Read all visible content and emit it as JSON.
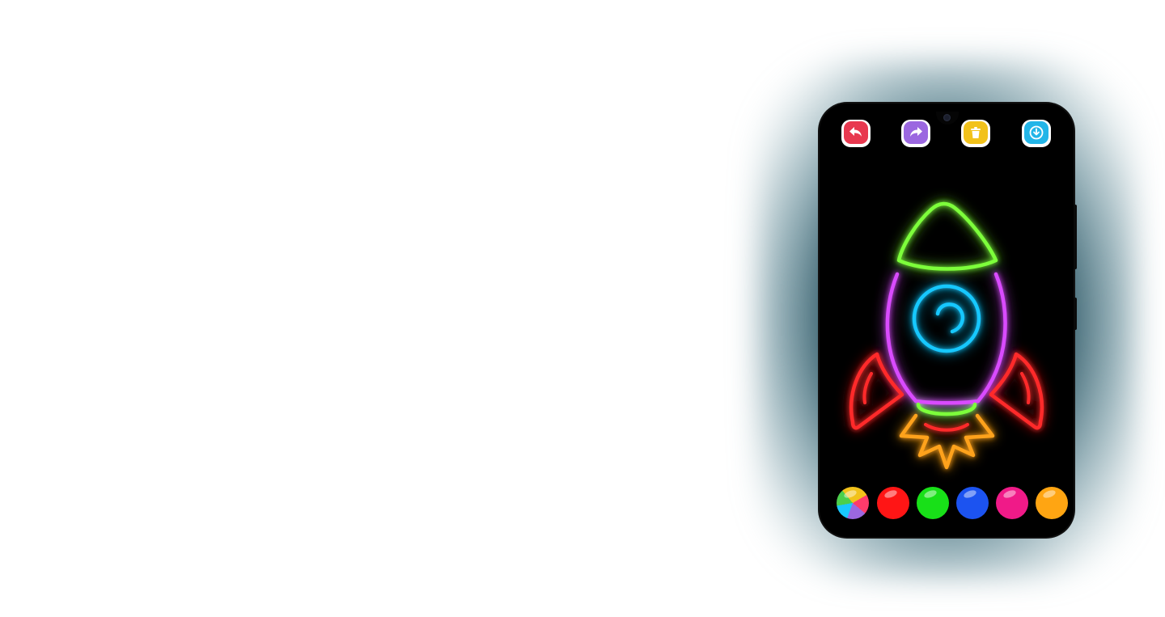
{
  "toolbar": {
    "buttons": [
      {
        "name": "undo",
        "icon": "undo-arrow-icon",
        "color": "#e8384f"
      },
      {
        "name": "redo",
        "icon": "redo-arrow-icon",
        "color": "#9b67e0"
      },
      {
        "name": "clear",
        "icon": "trash-icon",
        "color": "#f2c21b"
      },
      {
        "name": "save",
        "icon": "download-icon",
        "color": "#22b5e8"
      }
    ]
  },
  "artwork": {
    "subject": "rocket",
    "stroke_colors": {
      "nose_cone": "#7dff3a",
      "body": "#d94cff",
      "window": "#19c8ff",
      "fins": "#ff2a2a",
      "nozzle": "#7dff3a",
      "flame": "#ffa21a"
    }
  },
  "palette": {
    "swatches": [
      {
        "name": "multicolor",
        "color": "rainbow"
      },
      {
        "name": "red",
        "color": "#ff1515"
      },
      {
        "name": "green",
        "color": "#18e018"
      },
      {
        "name": "blue",
        "color": "#1c53f0"
      },
      {
        "name": "pink",
        "color": "#f01a88"
      },
      {
        "name": "orange",
        "color": "#ffa512"
      }
    ]
  }
}
